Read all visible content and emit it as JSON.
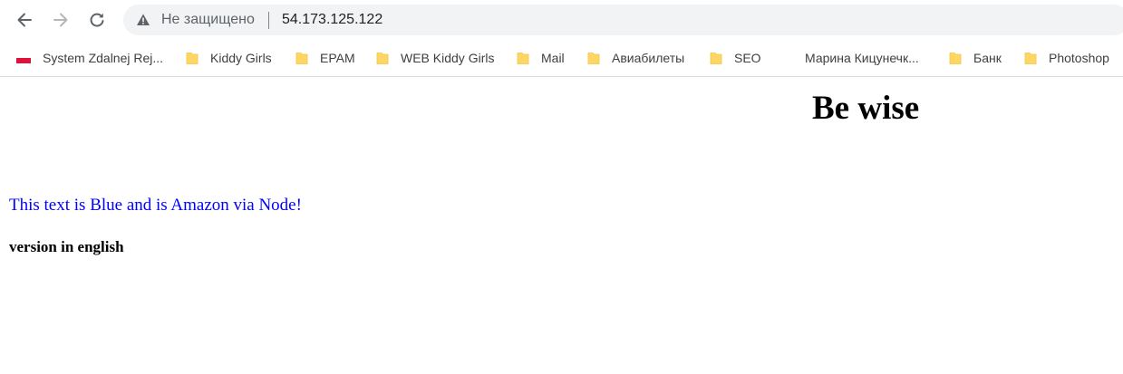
{
  "toolbar": {
    "security_label": "Не защищено",
    "url": "54.173.125.122"
  },
  "bookmarks": [
    {
      "label": "System Zdalnej Rej...",
      "icon": "poland-flag-icon"
    },
    {
      "label": "Kiddy Girls",
      "icon": "folder-icon"
    },
    {
      "label": "EPAM",
      "icon": "folder-icon"
    },
    {
      "label": "WEB Kiddy Girls",
      "icon": "folder-icon"
    },
    {
      "label": "Mail",
      "icon": "folder-icon"
    },
    {
      "label": "Авиабилеты",
      "icon": "folder-icon"
    },
    {
      "label": "SEO",
      "icon": "folder-icon"
    },
    {
      "label": "Марина Кицунечк...",
      "icon": "none"
    },
    {
      "label": "Банк",
      "icon": "folder-icon"
    },
    {
      "label": "Photoshop",
      "icon": "folder-icon"
    }
  ],
  "page": {
    "heading": "Be wise",
    "blue_text": "This text is Blue and is Amazon via Node!",
    "version": "version in english"
  },
  "colors": {
    "folder": "#fdd663",
    "folder_edge": "#f4c542",
    "flag_red": "#dc143c",
    "blue_text": "#0000ff"
  }
}
